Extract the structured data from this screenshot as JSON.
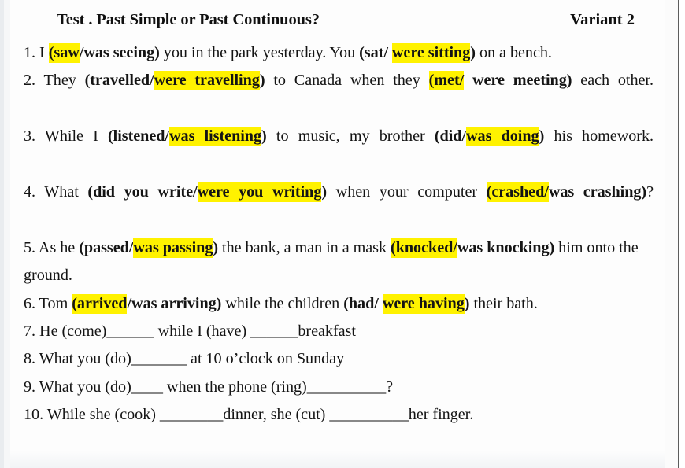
{
  "document": {
    "type": "grammar-worksheet",
    "header": {
      "title": "Test . Past Simple or Past Continuous?",
      "variant": "Variant 2"
    },
    "highlight_color": "#fff200",
    "text_color": "#141414",
    "page_color": "#fdfdfd",
    "items": [
      {
        "number": "1.",
        "justified": false,
        "segments": [
          {
            "text": "1. I ",
            "bold": false,
            "highlight": false
          },
          {
            "text": "(saw",
            "bold": true,
            "highlight": true
          },
          {
            "text": "/was seeing)",
            "bold": true,
            "highlight": false
          },
          {
            "text": " you in the park yesterday. You ",
            "bold": false,
            "highlight": false
          },
          {
            "text": "(sat/ ",
            "bold": true,
            "highlight": false
          },
          {
            "text": "were sitting",
            "bold": true,
            "highlight": true
          },
          {
            "text": ")",
            "bold": true,
            "highlight": false
          },
          {
            "text": " on a bench.",
            "bold": false,
            "highlight": false
          }
        ]
      },
      {
        "number": "2.",
        "justified": true,
        "segments": [
          {
            "text": "2. They ",
            "bold": false,
            "highlight": false
          },
          {
            "text": "(travelled/",
            "bold": true,
            "highlight": false
          },
          {
            "text": "were travelling",
            "bold": true,
            "highlight": true
          },
          {
            "text": ")",
            "bold": true,
            "highlight": false
          },
          {
            "text": " to Canada when they ",
            "bold": false,
            "highlight": false
          },
          {
            "text": "(met/",
            "bold": true,
            "highlight": true
          },
          {
            "text": " were meeting)",
            "bold": true,
            "highlight": false
          },
          {
            "text": " each other.",
            "bold": false,
            "highlight": false
          }
        ]
      },
      {
        "number": "3.",
        "justified": true,
        "segments": [
          {
            "text": "3. While I ",
            "bold": false,
            "highlight": false
          },
          {
            "text": "(listened/",
            "bold": true,
            "highlight": false
          },
          {
            "text": "was listening",
            "bold": true,
            "highlight": true
          },
          {
            "text": ")",
            "bold": true,
            "highlight": false
          },
          {
            "text": " to music, my brother ",
            "bold": false,
            "highlight": false
          },
          {
            "text": "(did/",
            "bold": true,
            "highlight": false
          },
          {
            "text": "was doing",
            "bold": true,
            "highlight": true
          },
          {
            "text": ")",
            "bold": true,
            "highlight": false
          },
          {
            "text": " his homework.",
            "bold": false,
            "highlight": false
          }
        ]
      },
      {
        "number": "4.",
        "justified": true,
        "segments": [
          {
            "text": "4. What ",
            "bold": false,
            "highlight": false
          },
          {
            "text": "(did you write/",
            "bold": true,
            "highlight": false
          },
          {
            "text": "were you writing",
            "bold": true,
            "highlight": true
          },
          {
            "text": ")",
            "bold": true,
            "highlight": false
          },
          {
            "text": " when your computer ",
            "bold": false,
            "highlight": false
          },
          {
            "text": "(crashed/",
            "bold": true,
            "highlight": true
          },
          {
            "text": "was crashing)",
            "bold": true,
            "highlight": false
          },
          {
            "text": "?",
            "bold": false,
            "highlight": false
          }
        ]
      },
      {
        "number": "5.",
        "justified": false,
        "segments": [
          {
            "text": "5. As he ",
            "bold": false,
            "highlight": false
          },
          {
            "text": "(passed/",
            "bold": true,
            "highlight": false
          },
          {
            "text": "was passing",
            "bold": true,
            "highlight": true
          },
          {
            "text": ")",
            "bold": true,
            "highlight": false
          },
          {
            "text": " the bank, a man in a mask ",
            "bold": false,
            "highlight": false
          },
          {
            "text": "(knocked/",
            "bold": true,
            "highlight": true
          },
          {
            "text": "was knocking)",
            "bold": true,
            "highlight": false
          },
          {
            "text": " him onto the ground.",
            "bold": false,
            "highlight": false
          }
        ]
      },
      {
        "number": "6.",
        "justified": false,
        "segments": [
          {
            "text": "6. Tom ",
            "bold": false,
            "highlight": false
          },
          {
            "text": "(arrived",
            "bold": true,
            "highlight": true
          },
          {
            "text": "/was arriving)",
            "bold": true,
            "highlight": false
          },
          {
            "text": " while the children ",
            "bold": false,
            "highlight": false
          },
          {
            "text": "(had/ ",
            "bold": true,
            "highlight": false
          },
          {
            "text": "were having",
            "bold": true,
            "highlight": true
          },
          {
            "text": ")",
            "bold": true,
            "highlight": false
          },
          {
            "text": " their bath.",
            "bold": false,
            "highlight": false
          }
        ]
      },
      {
        "number": "7.",
        "justified": false,
        "segments": [
          {
            "text": "7. He (come)______ while I (have) ______breakfast",
            "bold": false,
            "highlight": false
          }
        ]
      },
      {
        "number": "8.",
        "justified": false,
        "segments": [
          {
            "text": "8. What you (do)_______ at 10 o’clock on Sunday",
            "bold": false,
            "highlight": false
          }
        ]
      },
      {
        "number": "9.",
        "justified": false,
        "segments": [
          {
            "text": "9. What you (do)____ when the phone (ring)__________?",
            "bold": false,
            "highlight": false
          }
        ]
      },
      {
        "number": "10.",
        "justified": false,
        "segments": [
          {
            "text": "10. While she (cook) ________dinner, she (cut) __________her finger.",
            "bold": false,
            "highlight": false
          }
        ]
      }
    ]
  }
}
